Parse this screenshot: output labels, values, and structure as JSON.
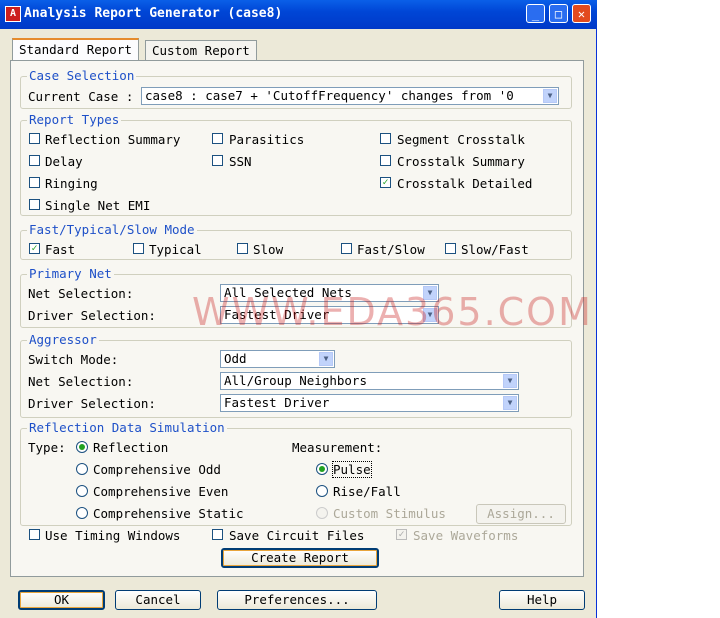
{
  "window": {
    "title": "Analysis Report Generator (case8)"
  },
  "tabs": [
    "Standard Report",
    "Custom Report"
  ],
  "case_selection": {
    "title": "Case Selection",
    "label": "Current Case :",
    "value": "case8 : case7 + 'CutoffFrequency' changes from '0"
  },
  "report_types": {
    "title": "Report Types",
    "items": [
      {
        "label": "Reflection Summary",
        "checked": false
      },
      {
        "label": "Parasitics",
        "checked": false
      },
      {
        "label": "Segment Crosstalk",
        "checked": false
      },
      {
        "label": "Delay",
        "checked": false
      },
      {
        "label": "SSN",
        "checked": false
      },
      {
        "label": "Crosstalk Summary",
        "checked": false
      },
      {
        "label": "Ringing",
        "checked": false
      },
      {
        "label": "Crosstalk Detailed",
        "checked": true
      },
      {
        "label": "Single Net EMI",
        "checked": false
      }
    ]
  },
  "mode": {
    "title": "Fast/Typical/Slow Mode",
    "items": [
      {
        "label": "Fast",
        "checked": true
      },
      {
        "label": "Typical",
        "checked": false
      },
      {
        "label": "Slow",
        "checked": false
      },
      {
        "label": "Fast/Slow",
        "checked": false
      },
      {
        "label": "Slow/Fast",
        "checked": false
      }
    ]
  },
  "primary_net": {
    "title": "Primary Net",
    "net_label": "Net Selection:",
    "net_value": "All Selected Nets",
    "driver_label": "Driver Selection:",
    "driver_value": "Fastest Driver"
  },
  "aggressor": {
    "title": "Aggressor",
    "switch_label": "Switch Mode:",
    "switch_value": "Odd",
    "net_label": "Net Selection:",
    "net_value": "All/Group Neighbors",
    "driver_label": "Driver Selection:",
    "driver_value": "Fastest Driver"
  },
  "reflection_sim": {
    "title": "Reflection Data Simulation",
    "type_label": "Type:",
    "types": [
      {
        "label": "Reflection",
        "selected": true
      },
      {
        "label": "Comprehensive Odd",
        "selected": false
      },
      {
        "label": "Comprehensive Even",
        "selected": false
      },
      {
        "label": "Comprehensive Static",
        "selected": false
      }
    ],
    "measurement_label": "Measurement:",
    "measurements": [
      {
        "label": "Pulse",
        "selected": true
      },
      {
        "label": "Rise/Fall",
        "selected": false
      },
      {
        "label": "Custom Stimulus",
        "selected": false,
        "disabled": true
      }
    ],
    "assign_label": "Assign..."
  },
  "options": {
    "timing_windows": "Use Timing Windows",
    "save_circuit": "Save Circuit Files",
    "save_waveforms": "Save Waveforms"
  },
  "buttons": {
    "create_report": "Create Report",
    "ok": "OK",
    "cancel": "Cancel",
    "preferences": "Preferences...",
    "help": "Help"
  },
  "watermark": "WWW.EDA365.COM",
  "colors": {
    "group_title": "#1e50c8",
    "titlebar": "#0a5fe8",
    "check": "#21a121"
  }
}
